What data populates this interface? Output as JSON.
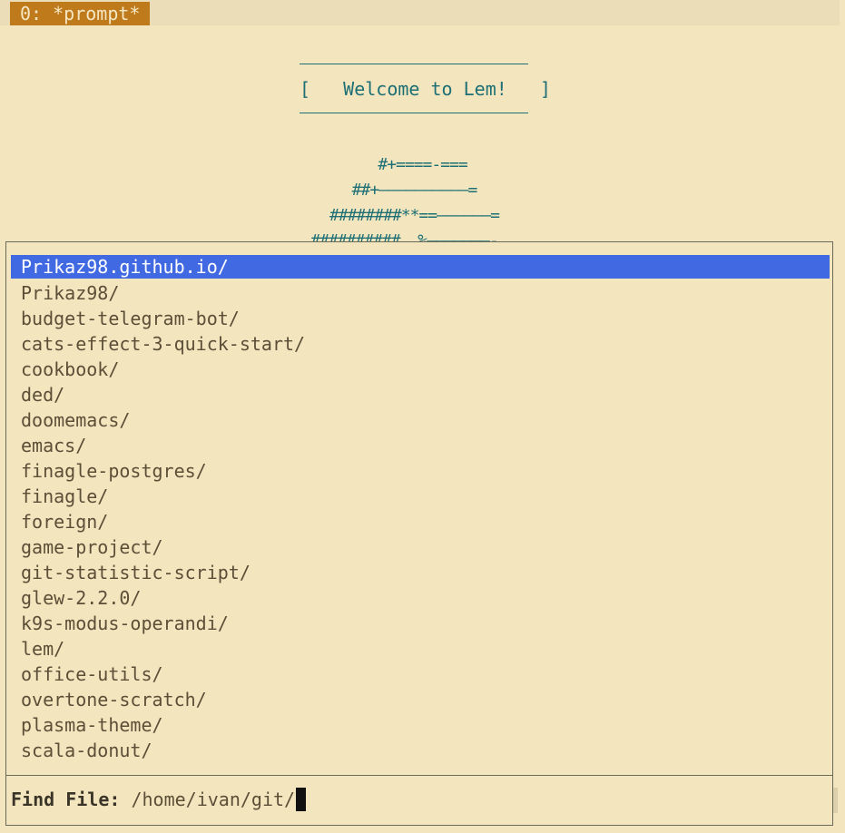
{
  "tabbar": {
    "active_tab": "0: *prompt*"
  },
  "banner": {
    "text": "[   Welcome to Lem!   ]"
  },
  "ascii_art": {
    "lines": [
      "#+====-===",
      "##+——————————=",
      "########**==——————=",
      "##########  %———————-"
    ]
  },
  "completion": {
    "items": [
      "Prikaz98.github.io/",
      "Prikaz98/",
      "budget-telegram-bot/",
      "cats-effect-3-quick-start/",
      "cookbook/",
      "ded/",
      "doomemacs/",
      "emacs/",
      "finagle-postgres/",
      "finagle/",
      "foreign/",
      "game-project/",
      "git-statistic-script/",
      "glew-2.2.0/",
      "k9s-modus-operandi/",
      "lem/",
      "office-utils/",
      "overtone-scratch/",
      "plasma-theme/",
      "scala-donut/"
    ],
    "selected_index": 0
  },
  "prompt": {
    "label": "Find File:",
    "value": "/home/ivan/git/"
  },
  "colors": {
    "background": "#f3e5bd",
    "tab_active": "#bf7a1b",
    "selection": "#4169e1",
    "banner_text": "#1d6f75"
  }
}
